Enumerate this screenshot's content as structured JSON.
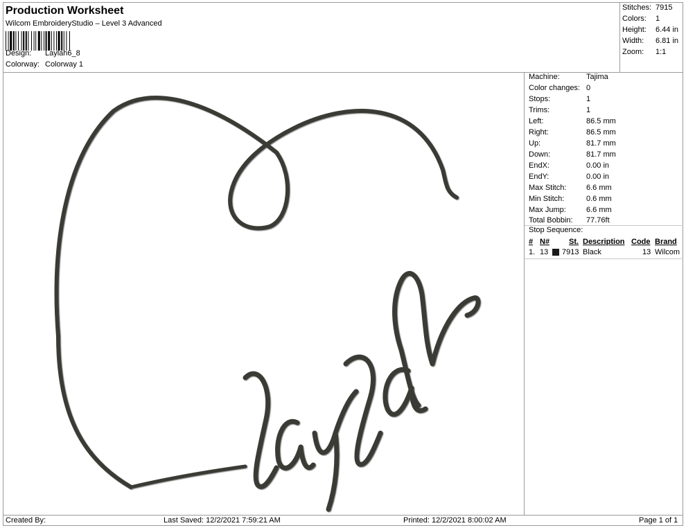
{
  "header": {
    "title": "Production Worksheet",
    "software": "Wilcom EmbroideryStudio – Level 3 Advanced",
    "design_label": "Design:",
    "design_value": "Laylah6_8",
    "colorway_label": "Colorway:",
    "colorway_value": "Colorway 1"
  },
  "stats": [
    {
      "label": "Stitches:",
      "value": "7915"
    },
    {
      "label": "Colors:",
      "value": "1"
    },
    {
      "label": "Height:",
      "value": "6.44 in"
    },
    {
      "label": "Width:",
      "value": "6.81 in"
    },
    {
      "label": "Zoom:",
      "value": "1:1"
    }
  ],
  "machine_info": [
    {
      "label": "Machine:",
      "value": "Tajima"
    },
    {
      "label": "Color changes:",
      "value": "0"
    },
    {
      "label": "Stops:",
      "value": "1"
    },
    {
      "label": "Trims:",
      "value": "1"
    },
    {
      "label": "Left:",
      "value": "86.5 mm"
    },
    {
      "label": "Right:",
      "value": "86.5 mm"
    },
    {
      "label": "Up:",
      "value": "81.7 mm"
    },
    {
      "label": "Down:",
      "value": "81.7 mm"
    },
    {
      "label": "EndX:",
      "value": "0.00 in"
    },
    {
      "label": "EndY:",
      "value": "0.00 in"
    },
    {
      "label": "Max Stitch:",
      "value": "6.6 mm"
    },
    {
      "label": "Min Stitch:",
      "value": "0.6 mm"
    },
    {
      "label": "Max Jump:",
      "value": "6.6 mm"
    },
    {
      "label": "Total Bobbin:",
      "value": "77.76ft"
    }
  ],
  "stop_sequence": {
    "title": "Stop Sequence:",
    "headers": {
      "num": "#",
      "n": "N#",
      "st": "St.",
      "description": "Description",
      "code": "Code",
      "brand": "Brand"
    },
    "rows": [
      {
        "num": "1.",
        "n": "13",
        "swatch_color": "#1a1a1a",
        "st": "7913",
        "description": "Black",
        "code": "13",
        "brand": "Wilcom"
      }
    ]
  },
  "design_preview": {
    "text": "laylah",
    "thread_color": "#3a3a36",
    "highlight_color": "#6a6a62"
  },
  "footer": {
    "created_by": "Created By:",
    "last_saved": "Last Saved: 12/2/2021 7:59:21 AM",
    "printed": "Printed: 12/2/2021 8:00:02 AM",
    "page": "Page 1 of 1"
  }
}
